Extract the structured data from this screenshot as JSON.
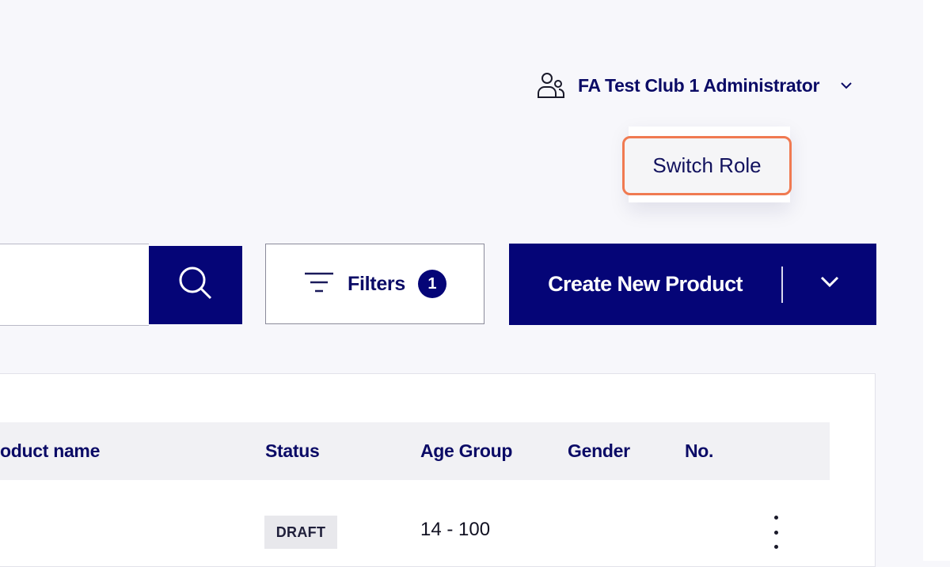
{
  "header": {
    "user_name": "FA Test Club 1 Administrator",
    "user_icon": "users-icon",
    "dropdown_icon": "chevron-down-icon"
  },
  "role_menu": {
    "switch_role_label": "Switch Role"
  },
  "toolbar": {
    "search_placeholder": "",
    "search_icon": "search-icon",
    "filters_label": "Filters",
    "filters_count": "1",
    "create_label": "Create New Product"
  },
  "table": {
    "columns": [
      "oduct name",
      "Status",
      "Age Group",
      "Gender",
      "No."
    ],
    "rows": [
      {
        "status": "DRAFT",
        "age_group": "14 - 100"
      }
    ]
  },
  "colors": {
    "primary": "#050577",
    "highlight": "#f07a51",
    "background": "#f7f7fb"
  }
}
